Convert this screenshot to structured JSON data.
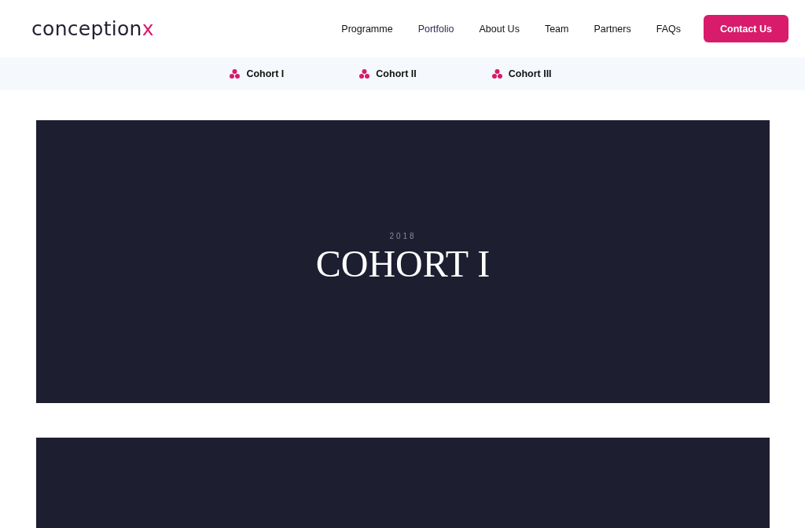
{
  "logo": {
    "main": "conception",
    "accent": "x"
  },
  "nav": [
    {
      "label": "Programme",
      "selected": false
    },
    {
      "label": "Portfolio",
      "selected": true
    },
    {
      "label": "About Us",
      "selected": false
    },
    {
      "label": "Team",
      "selected": false
    },
    {
      "label": "Partners",
      "selected": false
    },
    {
      "label": "FAQs",
      "selected": false
    }
  ],
  "cta": "Contact Us",
  "cohort_links": [
    "Cohort I",
    "Cohort II",
    "Cohort III"
  ],
  "cards": [
    {
      "kind": "titled",
      "year": "2018",
      "title": "COHORT I"
    },
    {
      "kind": "blank"
    }
  ]
}
